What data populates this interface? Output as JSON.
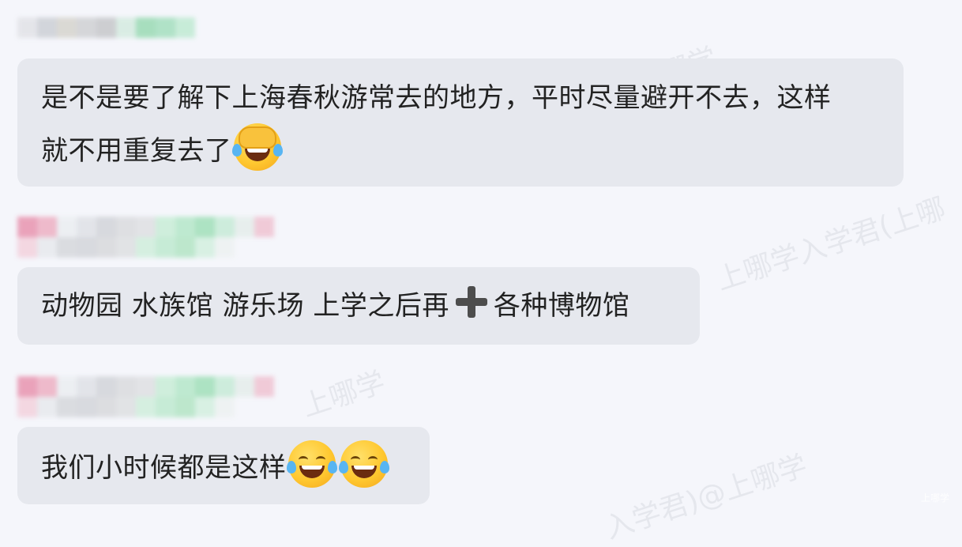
{
  "messages": [
    {
      "text_line1": "是不是要了解下上海春秋游常去的地方，平时尽量避开不去，这样",
      "text_line2": "就不用重复去了",
      "emojis": [
        "facepalm-crying-emoji"
      ]
    },
    {
      "text_part1": "动物园 水族馆 游乐场 上学之后再",
      "text_part2": "各种博物馆",
      "icons": [
        "heavy-plus-icon"
      ]
    },
    {
      "text": "我们小时候都是这样",
      "emojis": [
        "tears-of-joy-emoji",
        "tears-of-joy-emoji"
      ]
    }
  ],
  "watermark": {
    "text1": "上哪学",
    "text2": "上哪学入学君(上哪",
    "text3": "入学君)@上哪学",
    "corner": "上哪学"
  }
}
